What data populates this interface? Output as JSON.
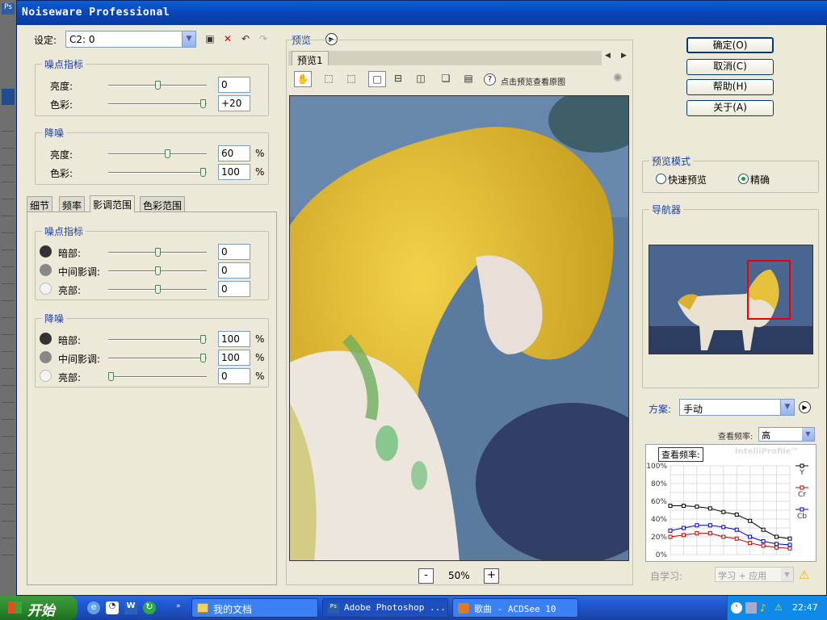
{
  "ps_strip": {
    "logo": "Ps"
  },
  "title": "Noiseware Professional",
  "settings": {
    "label": "设定:",
    "value": "C2: 0"
  },
  "noise_level": {
    "title": "噪点指标",
    "brightness_label": "亮度:",
    "brightness_value": "0",
    "color_label": "色彩:",
    "color_value": "+20"
  },
  "denoise": {
    "title": "降噪",
    "brightness_label": "亮度:",
    "brightness_value": "60",
    "brightness_unit": "%",
    "color_label": "色彩:",
    "color_value": "100",
    "color_unit": "%"
  },
  "tabs": [
    "细节",
    "频率",
    "影调范围",
    "色彩范围"
  ],
  "tonal_noise": {
    "title": "噪点指标",
    "shadow_label": "暗部:",
    "shadow_value": "0",
    "mid_label": "中间影调:",
    "mid_value": "0",
    "high_label": "亮部:",
    "high_value": "0"
  },
  "tonal_denoise": {
    "title": "降噪",
    "shadow_label": "暗部:",
    "shadow_value": "100",
    "shadow_unit": "%",
    "mid_label": "中间影调:",
    "mid_value": "100",
    "mid_unit": "%",
    "high_label": "亮部:",
    "high_value": "0",
    "high_unit": "%"
  },
  "preview": {
    "title": "预览",
    "tab": "预览1",
    "hint": "点击预览查看原图",
    "zoom": "50%",
    "zoom_minus": "-",
    "zoom_plus": "+"
  },
  "buttons": {
    "ok": "确定(O)",
    "cancel": "取消(C)",
    "help": "帮助(H)",
    "about": "关于(A)"
  },
  "preview_mode": {
    "title": "预览模式",
    "fast": "快速预览",
    "accurate": "精确",
    "selected": "accurate"
  },
  "navigator": {
    "title": "导航器"
  },
  "profile": {
    "label": "方案:",
    "value": "手动",
    "freq_label": "查看频率:",
    "freq_value": "高",
    "chart_tag": "查看频率:",
    "intelli": "IntelliProfile™",
    "learn_label": "自学习:",
    "learn_value": "学习 + 应用"
  },
  "chart_data": {
    "type": "line",
    "x": [
      1,
      2,
      3,
      4,
      5,
      6,
      7,
      8,
      9,
      10
    ],
    "yticks": [
      "100%",
      "80%",
      "60%",
      "40%",
      "20%",
      "0%"
    ],
    "ylim": [
      0,
      100
    ],
    "series": [
      {
        "name": "Y",
        "color": "#000000",
        "values": [
          55,
          55,
          54,
          52,
          48,
          45,
          38,
          28,
          20,
          18
        ]
      },
      {
        "name": "Cr",
        "color": "#c00000",
        "values": [
          20,
          22,
          24,
          24,
          20,
          18,
          13,
          10,
          8,
          7
        ]
      },
      {
        "name": "Cb",
        "color": "#0000c0",
        "values": [
          27,
          30,
          33,
          33,
          31,
          28,
          20,
          15,
          12,
          11
        ]
      }
    ]
  },
  "taskbar": {
    "start": "开始",
    "tasks": [
      "我的文档",
      "Adobe Photoshop ...",
      "歌曲 - ACDSee 10"
    ],
    "time": "22:47"
  }
}
